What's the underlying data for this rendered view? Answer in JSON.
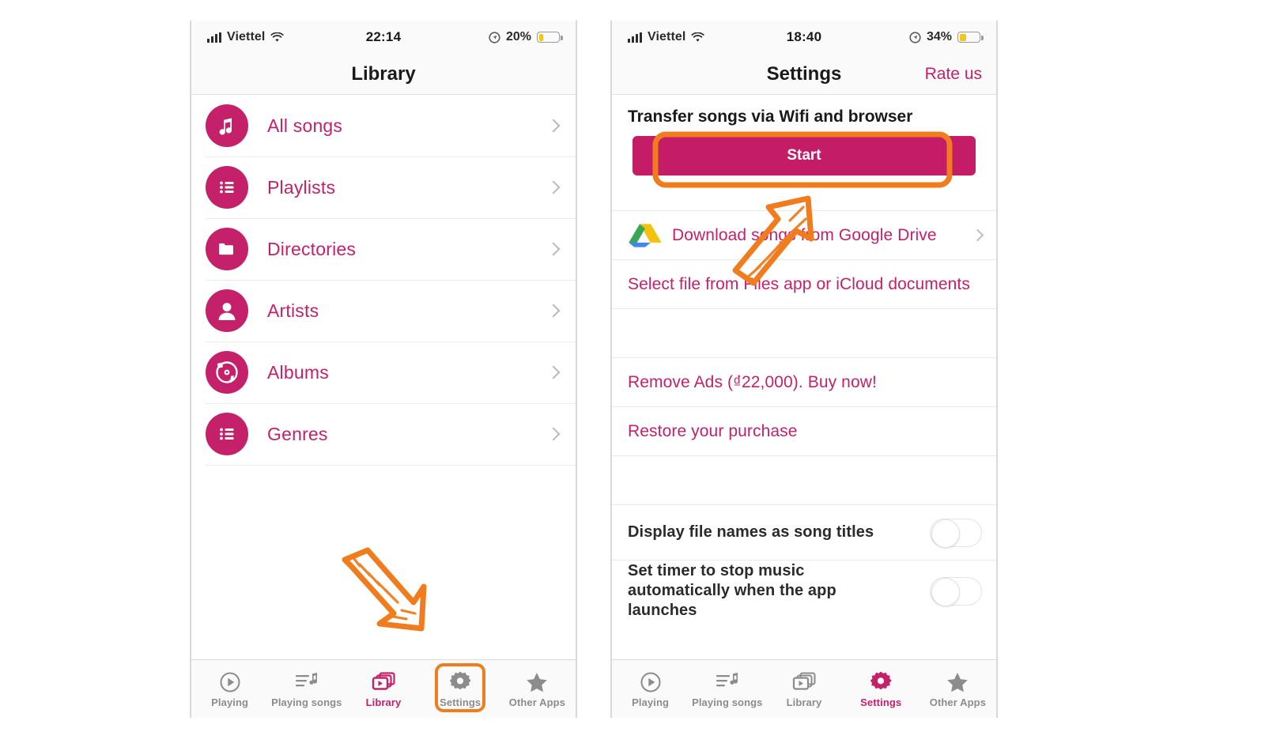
{
  "accent": "#C4216A",
  "accent_button": "#C41C66",
  "highlight": "#F07C1E",
  "left_phone": {
    "status": {
      "carrier": "Viettel",
      "time": "22:14",
      "battery_pct": "20%",
      "signal_icon": "signal-bars-icon",
      "wifi_icon": "wifi-icon",
      "location_icon": "location-arrow-icon",
      "battery_icon": "battery-icon"
    },
    "nav": {
      "title": "Library"
    },
    "list": [
      {
        "label": "All songs",
        "icon": "music-note-icon"
      },
      {
        "label": "Playlists",
        "icon": "list-icon"
      },
      {
        "label": "Directories",
        "icon": "folder-icon"
      },
      {
        "label": "Artists",
        "icon": "person-icon"
      },
      {
        "label": "Albums",
        "icon": "vinyl-record-icon"
      },
      {
        "label": "Genres",
        "icon": "list-icon"
      }
    ],
    "tabs": [
      {
        "label": "Playing",
        "icon": "play-circle-icon",
        "active": false,
        "highlighted": false
      },
      {
        "label": "Playing songs",
        "icon": "queue-list-icon",
        "active": false,
        "highlighted": false
      },
      {
        "label": "Library",
        "icon": "library-stack-icon",
        "active": true,
        "highlighted": false
      },
      {
        "label": "Settings",
        "icon": "gear-icon",
        "active": false,
        "highlighted": true
      },
      {
        "label": "Other Apps",
        "icon": "star-icon",
        "active": false,
        "highlighted": false
      }
    ]
  },
  "right_phone": {
    "status": {
      "carrier": "Viettel",
      "time": "18:40",
      "battery_pct": "34%",
      "signal_icon": "signal-bars-icon",
      "wifi_icon": "wifi-icon",
      "location_icon": "location-arrow-icon",
      "battery_icon": "battery-icon"
    },
    "nav": {
      "title": "Settings",
      "right_action": "Rate us"
    },
    "section_header": "Transfer songs via Wifi and browser",
    "start_button": "Start",
    "rows": [
      {
        "label": "Download songs from Google Drive",
        "icon": "google-drive-icon",
        "chevron": true,
        "style": "accent"
      },
      {
        "label": "Select file from Files app or iCloud documents",
        "icon": null,
        "chevron": false,
        "style": "accent"
      },
      {
        "label": "Remove Ads (₫22,000). Buy now!",
        "icon": null,
        "chevron": false,
        "style": "accent"
      },
      {
        "label": "Restore your purchase",
        "icon": null,
        "chevron": false,
        "style": "accent"
      }
    ],
    "toggles": [
      {
        "label": "Display file names as song titles",
        "on": false
      },
      {
        "label": "Set timer to stop music automatically when the app launches",
        "on": false
      }
    ],
    "tabs": [
      {
        "label": "Playing",
        "icon": "play-circle-icon",
        "active": false
      },
      {
        "label": "Playing songs",
        "icon": "queue-list-icon",
        "active": false
      },
      {
        "label": "Library",
        "icon": "library-stack-icon",
        "active": false
      },
      {
        "label": "Settings",
        "icon": "gear-icon",
        "active": true
      },
      {
        "label": "Other Apps",
        "icon": "star-icon",
        "active": false
      }
    ]
  },
  "annotations": {
    "arrow_left": {
      "name": "hand-drawn-arrow-down-right",
      "target": "settings-tab"
    },
    "arrow_right": {
      "name": "hand-drawn-arrow-up-right",
      "target": "start-button"
    },
    "box_start": {
      "name": "highlight-box-start-button"
    },
    "box_settings": {
      "name": "highlight-box-settings-tab"
    }
  }
}
